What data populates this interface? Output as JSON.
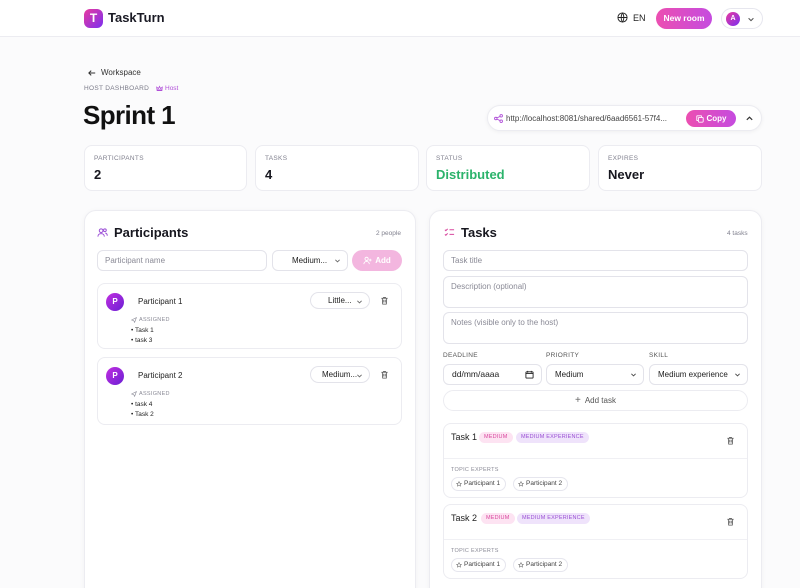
{
  "header": {
    "brand": "TaskTurn",
    "logo_letter": "T",
    "language": "EN",
    "new_room_label": "New room",
    "user_initial": "A"
  },
  "breadcrumb": {
    "back_label": "Workspace"
  },
  "page": {
    "overline": "HOST DASHBOARD",
    "host_badge": "Host",
    "title": "Sprint 1"
  },
  "share": {
    "url": "http://localhost:8081/shared/6aad6561-57f4...",
    "copy_label": "Copy"
  },
  "stats": [
    {
      "label": "PARTICIPANTS",
      "value": "2"
    },
    {
      "label": "TASKS",
      "value": "4"
    },
    {
      "label": "STATUS",
      "value": "Distributed"
    },
    {
      "label": "EXPIRES",
      "value": "Never"
    }
  ],
  "participants": {
    "title": "Participants",
    "count": "2 people",
    "name_placeholder": "Participant name",
    "skill_select": "Medium...",
    "add_label": "Add",
    "assigned_label": "ASSIGNED",
    "items": [
      {
        "initial": "P",
        "name": "Participant 1",
        "skill": "Little...",
        "tasks": [
          "• Task 1",
          "• task 3"
        ]
      },
      {
        "initial": "P",
        "name": "Participant 2",
        "skill": "Medium...",
        "tasks": [
          "• task 4",
          "• Task 2"
        ]
      }
    ]
  },
  "tasks": {
    "title": "Tasks",
    "count": "4 tasks",
    "title_placeholder": "Task title",
    "description_placeholder": "Description (optional)",
    "notes_placeholder": "Notes (visible only to the host)",
    "deadline_label": "DEADLINE",
    "deadline_value": "dd/mm/aaaa",
    "priority_label": "PRIORITY",
    "priority_value": "Medium",
    "skill_label": "SKILL",
    "skill_value": "Medium experience",
    "add_task_label": "Add task",
    "topic_experts_label": "TOPIC EXPERTS",
    "items": [
      {
        "name": "Task 1",
        "priority": "MEDIUM",
        "experience": "MEDIUM EXPERIENCE",
        "experts": [
          "Participant 1",
          "Participant 2"
        ]
      },
      {
        "name": "Task 2",
        "priority": "MEDIUM",
        "experience": "MEDIUM EXPERIENCE",
        "experts": [
          "Participant 1",
          "Participant 2"
        ]
      }
    ]
  }
}
